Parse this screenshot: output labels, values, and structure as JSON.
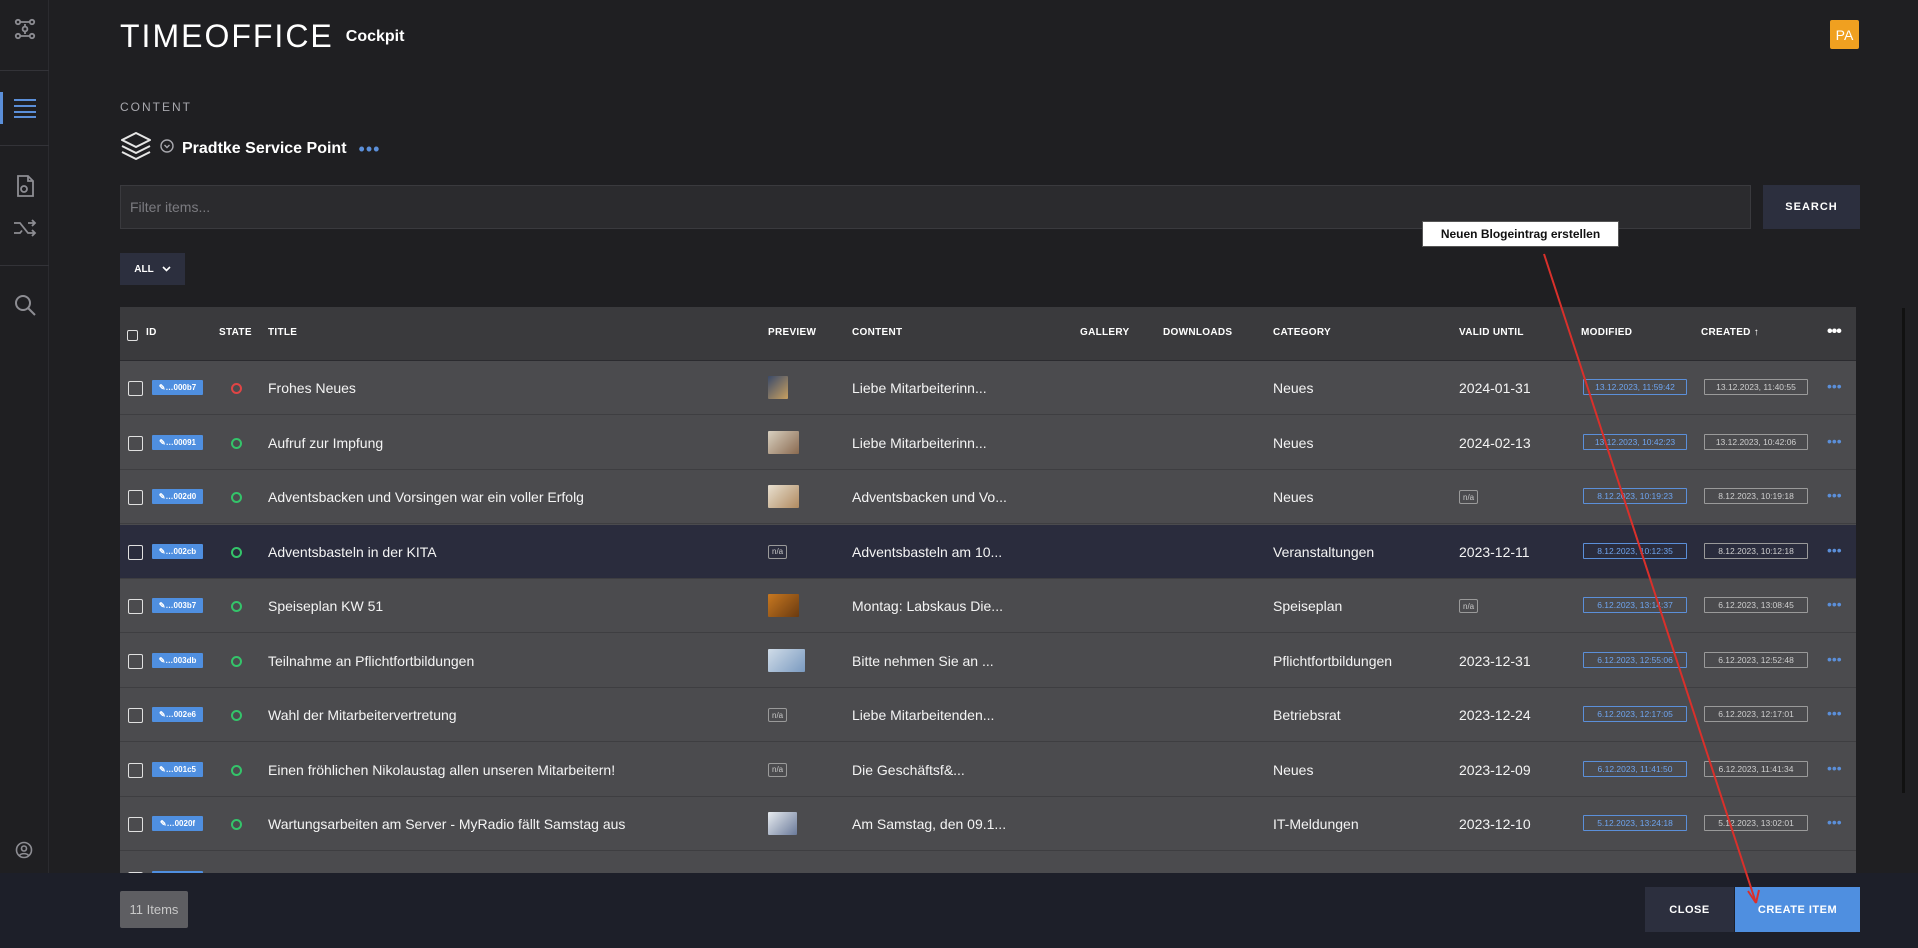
{
  "app": {
    "logo": "TIMEOFFICE",
    "subtitle": "Cockpit",
    "avatar_initials": "PA"
  },
  "section_label": "CONTENT",
  "project": {
    "name": "Pradtke Service Point",
    "more": "•••"
  },
  "filter": {
    "placeholder": "Filter items..."
  },
  "search_label": "SEARCH",
  "all_filter": {
    "label": "ALL"
  },
  "columns": {
    "id": "ID",
    "state": "STATE",
    "title": "TITLE",
    "preview": "PREVIEW",
    "content": "CONTENT",
    "gallery": "GALLERY",
    "downloads": "DOWNLOADS",
    "category": "CATEGORY",
    "valid_until": "VALID UNTIL",
    "modified": "MODIFIED",
    "created": "CREATED ↑"
  },
  "rows": [
    {
      "id": "✎…000b7",
      "state": "red",
      "title": "Frohes Neues",
      "preview": "image",
      "content": "Liebe Mitarbeiterinn...",
      "category": "Neues",
      "valid_until": "2024-01-31",
      "modified": "13.12.2023, 11:59:42",
      "created": "13.12.2023, 11:40:55"
    },
    {
      "id": "✎…00091",
      "state": "green",
      "title": "Aufruf zur Impfung",
      "preview": "image",
      "content": "Liebe Mitarbeiterinn...",
      "category": "Neues",
      "valid_until": "2024-02-13",
      "modified": "13.12.2023, 10:42:23",
      "created": "13.12.2023, 10:42:06"
    },
    {
      "id": "✎…002d0",
      "state": "green",
      "title": "Adventsbacken und Vorsingen war ein voller Erfolg",
      "preview": "image",
      "content": "Adventsbacken und Vo...",
      "category": "Neues",
      "valid_until": "n/a",
      "modified": "8.12.2023, 10:19:23",
      "created": "8.12.2023, 10:19:18"
    },
    {
      "id": "✎…002cb",
      "state": "green",
      "title": "Adventsbasteln in der KITA",
      "preview": "n/a",
      "content": "Adventsbasteln am 10...",
      "category": "Veranstaltungen",
      "valid_until": "2023-12-11",
      "modified": "8.12.2023, 10:12:35",
      "created": "8.12.2023, 10:12:18"
    },
    {
      "id": "✎…003b7",
      "state": "green",
      "title": "Speiseplan KW 51",
      "preview": "image",
      "content": "Montag: Labskaus Die...",
      "category": "Speiseplan",
      "valid_until": "n/a",
      "modified": "6.12.2023, 13:14:37",
      "created": "6.12.2023, 13:08:45"
    },
    {
      "id": "✎…003db",
      "state": "green",
      "title": "Teilnahme an Pflichtfortbildungen",
      "preview": "image",
      "content": "Bitte nehmen Sie an ...",
      "category": "Pflichtfortbildungen",
      "valid_until": "2023-12-31",
      "modified": "6.12.2023, 12:55:06",
      "created": "6.12.2023, 12:52:48"
    },
    {
      "id": "✎…002e6",
      "state": "green",
      "title": "Wahl der Mitarbeitervertretung",
      "preview": "n/a",
      "content": "Liebe Mitarbeitenden...",
      "category": "Betriebsrat",
      "valid_until": "2023-12-24",
      "modified": "6.12.2023, 12:17:05",
      "created": "6.12.2023, 12:17:01"
    },
    {
      "id": "✎…001c5",
      "state": "green",
      "title": "Einen fröhlichen Nikolaustag allen unseren Mitarbeitern!",
      "preview": "n/a",
      "content": "Die Geschäftsf&...",
      "category": "Neues",
      "valid_until": "2023-12-09",
      "modified": "6.12.2023, 11:41:50",
      "created": "6.12.2023, 11:41:34"
    },
    {
      "id": "✎…0020f",
      "state": "green",
      "title": "Wartungsarbeiten am Server - MyRadio fällt Samstag aus",
      "preview": "image",
      "content": "Am Samstag, den 09.1...",
      "category": "IT-Meldungen",
      "valid_until": "2023-12-10",
      "modified": "5.12.2023, 13:24:18",
      "created": "5.12.2023, 13:02:01"
    }
  ],
  "footer": {
    "count": "11 Items",
    "close": "CLOSE",
    "create": "CREATE ITEM"
  },
  "annotation": {
    "text": "Neuen Blogeintrag erstellen"
  },
  "colors": {
    "accent": "#4f8fe0",
    "state_ok": "#34c46a",
    "state_error": "#e04545",
    "avatar": "#f0a020",
    "annotation_arrow": "#d9302b"
  }
}
